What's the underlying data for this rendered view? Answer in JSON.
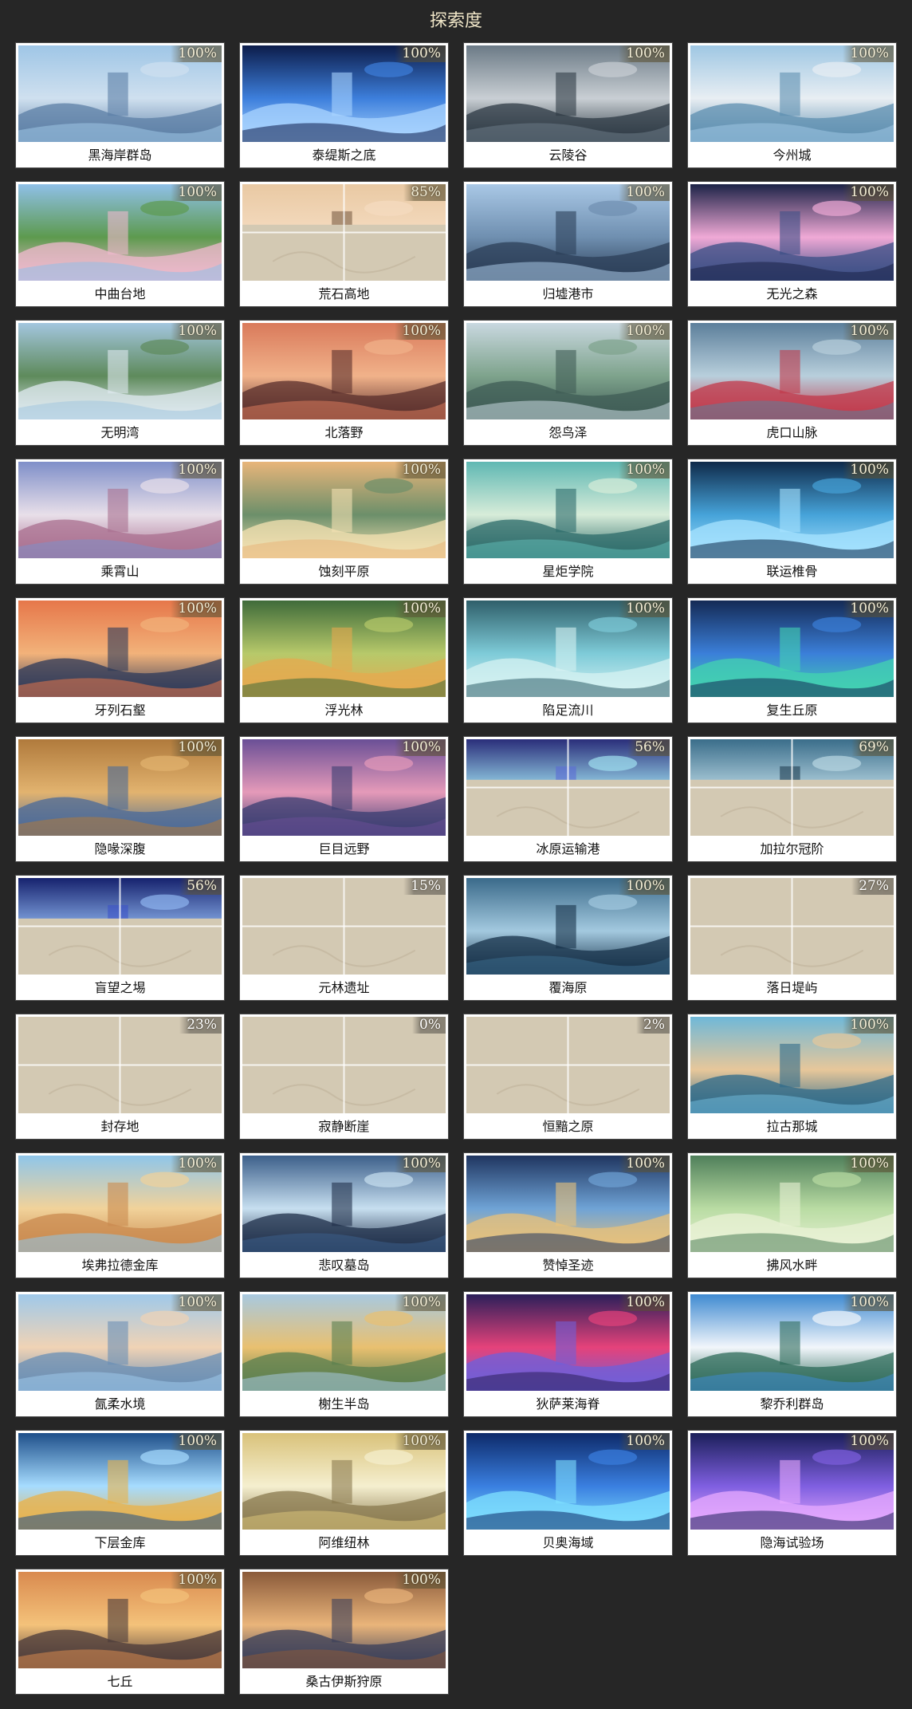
{
  "header": {
    "title": "探索度"
  },
  "regions": [
    {
      "name": "黑海岸群岛",
      "progress": "100%",
      "image": "region-thumbnail-image",
      "reveal": 1,
      "palette": [
        "#9fc6e6",
        "#cfe0ef",
        "#5c7fa6"
      ]
    },
    {
      "name": "泰缇斯之底",
      "progress": "100%",
      "image": "region-thumbnail-image",
      "reveal": 1,
      "palette": [
        "#0c1c4a",
        "#3d7fdc",
        "#a9d4ff"
      ]
    },
    {
      "name": "云陵谷",
      "progress": "100%",
      "image": "region-thumbnail-image",
      "reveal": 1,
      "palette": [
        "#6b7a86",
        "#c9cfd4",
        "#2e3a44"
      ]
    },
    {
      "name": "今州城",
      "progress": "100%",
      "image": "region-thumbnail-image",
      "reveal": 1,
      "palette": [
        "#9fc7e3",
        "#e8eef3",
        "#5e8fb0"
      ]
    },
    {
      "name": "中曲台地",
      "progress": "100%",
      "image": "region-thumbnail-image",
      "reveal": 1,
      "palette": [
        "#8fc0e8",
        "#5d9a4e",
        "#f0b9cf"
      ]
    },
    {
      "name": "荒石高地",
      "progress": "85%",
      "image": "region-thumbnail-image",
      "reveal": 0.85,
      "palette": [
        "#e9c9a3",
        "#f5dcc1",
        "#7a5d45"
      ]
    },
    {
      "name": "归墟港市",
      "progress": "100%",
      "image": "region-thumbnail-image",
      "reveal": 1,
      "palette": [
        "#a9c8e6",
        "#6f8fb0",
        "#2c3f58"
      ]
    },
    {
      "name": "无光之森",
      "progress": "100%",
      "image": "region-thumbnail-image",
      "reveal": 1,
      "palette": [
        "#1c2347",
        "#f0a9d6",
        "#3b4f86"
      ]
    },
    {
      "name": "无明湾",
      "progress": "100%",
      "image": "region-thumbnail-image",
      "reveal": 1,
      "palette": [
        "#a3c6df",
        "#5e8a5b",
        "#dfe9f0"
      ]
    },
    {
      "name": "北落野",
      "progress": "100%",
      "image": "region-thumbnail-image",
      "reveal": 1,
      "palette": [
        "#d97a5b",
        "#f1b28a",
        "#5a2f2c"
      ]
    },
    {
      "name": "怨鸟泽",
      "progress": "100%",
      "image": "region-thumbnail-image",
      "reveal": 1,
      "palette": [
        "#c9d8e0",
        "#7ea38c",
        "#3f5c55"
      ]
    },
    {
      "name": "虎口山脉",
      "progress": "100%",
      "image": "region-thumbnail-image",
      "reveal": 1,
      "palette": [
        "#5c7f9b",
        "#b8cfdc",
        "#c2384a"
      ]
    },
    {
      "name": "乘霄山",
      "progress": "100%",
      "image": "region-thumbnail-image",
      "reveal": 1,
      "palette": [
        "#7f8fc9",
        "#e8dfe9",
        "#a96f8f"
      ]
    },
    {
      "name": "蚀刻平原",
      "progress": "100%",
      "image": "region-thumbnail-image",
      "reveal": 1,
      "palette": [
        "#e8b57a",
        "#6c8f6a",
        "#f4e1b2"
      ]
    },
    {
      "name": "星炬学院",
      "progress": "100%",
      "image": "region-thumbnail-image",
      "reveal": 1,
      "palette": [
        "#5fb8b3",
        "#d7ecd9",
        "#2c6b6a"
      ]
    },
    {
      "name": "联运椎骨",
      "progress": "100%",
      "image": "region-thumbnail-image",
      "reveal": 1,
      "palette": [
        "#0f2a4a",
        "#46a3d9",
        "#a7e3ff"
      ]
    },
    {
      "name": "牙列石壑",
      "progress": "100%",
      "image": "region-thumbnail-image",
      "reveal": 1,
      "palette": [
        "#e6774a",
        "#f2b27a",
        "#2d3a5a"
      ]
    },
    {
      "name": "浮光林",
      "progress": "100%",
      "image": "region-thumbnail-image",
      "reveal": 1,
      "palette": [
        "#3f6b3a",
        "#b7c96a",
        "#e6a94f"
      ]
    },
    {
      "name": "陷足流川",
      "progress": "100%",
      "image": "region-thumbnail-image",
      "reveal": 1,
      "palette": [
        "#2f5f6a",
        "#7ecbd8",
        "#d6f2f2"
      ]
    },
    {
      "name": "复生丘原",
      "progress": "100%",
      "image": "region-thumbnail-image",
      "reveal": 1,
      "palette": [
        "#142a55",
        "#3b7fd9",
        "#43d3b0"
      ]
    },
    {
      "name": "隐喙深腹",
      "progress": "100%",
      "image": "region-thumbnail-image",
      "reveal": 1,
      "palette": [
        "#b07a3c",
        "#e2b36f",
        "#4a6a9a"
      ]
    },
    {
      "name": "巨目远野",
      "progress": "100%",
      "image": "region-thumbnail-image",
      "reveal": 1,
      "palette": [
        "#6a4f96",
        "#e59ab9",
        "#3a3d72"
      ]
    },
    {
      "name": "冰原运输港",
      "progress": "56%",
      "image": "region-thumbnail-image",
      "reveal": 0.56,
      "palette": [
        "#2a2e7a",
        "#9fdff0",
        "#5a6bd6"
      ]
    },
    {
      "name": "加拉尔冠阶",
      "progress": "69%",
      "image": "region-thumbnail-image",
      "reveal": 0.69,
      "palette": [
        "#3a6d8a",
        "#b9d7e3",
        "#1f3d52"
      ]
    },
    {
      "name": "盲望之埸",
      "progress": "56%",
      "image": "region-thumbnail-image",
      "reveal": 0.56,
      "palette": [
        "#16226e",
        "#8fb5ef",
        "#3b52c8"
      ]
    },
    {
      "name": "元林遗址",
      "progress": "15%",
      "image": "region-thumbnail-image",
      "reveal": 0.15,
      "palette": [
        "#d8cfbb",
        "#c9bfa6",
        "#b4a98f"
      ]
    },
    {
      "name": "覆海原",
      "progress": "100%",
      "image": "region-thumbnail-image",
      "reveal": 1,
      "palette": [
        "#3a6a8a",
        "#a3c9df",
        "#17324a"
      ]
    },
    {
      "name": "落日堤屿",
      "progress": "27%",
      "image": "region-thumbnail-image",
      "reveal": 0.27,
      "palette": [
        "#b9a3d4",
        "#e8e1f2",
        "#6c6aa8"
      ]
    },
    {
      "name": "封存地",
      "progress": "23%",
      "image": "region-thumbnail-image",
      "reveal": 0.23,
      "palette": [
        "#d8cfbb",
        "#c9bfa6",
        "#b4a98f"
      ]
    },
    {
      "name": "寂静断崖",
      "progress": "0%",
      "image": "region-thumbnail-image",
      "reveal": 0,
      "palette": [
        "#d8cfbb",
        "#c9bfa6",
        "#b4a98f"
      ]
    },
    {
      "name": "恒黯之原",
      "progress": "2%",
      "image": "region-thumbnail-image",
      "reveal": 0.02,
      "palette": [
        "#d8cfbb",
        "#c9bfa6",
        "#b4a98f"
      ]
    },
    {
      "name": "拉古那城",
      "progress": "100%",
      "image": "region-thumbnail-image",
      "reveal": 1,
      "palette": [
        "#6fb8d8",
        "#e7c79a",
        "#2e6a8a"
      ]
    },
    {
      "name": "埃弗拉德金库",
      "progress": "100%",
      "image": "region-thumbnail-image",
      "reveal": 1,
      "palette": [
        "#8fc6ea",
        "#f1d29a",
        "#c98a4f"
      ]
    },
    {
      "name": "悲叹墓岛",
      "progress": "100%",
      "image": "region-thumbnail-image",
      "reveal": 1,
      "palette": [
        "#3c5f8a",
        "#c7dff0",
        "#1f2f4a"
      ]
    },
    {
      "name": "赞悼圣迹",
      "progress": "100%",
      "image": "region-thumbnail-image",
      "reveal": 1,
      "palette": [
        "#1f3560",
        "#6fa3d6",
        "#e9c27a"
      ]
    },
    {
      "name": "拂风水畔",
      "progress": "100%",
      "image": "region-thumbnail-image",
      "reveal": 1,
      "palette": [
        "#4f7f5a",
        "#b9dca3",
        "#e9f2d6"
      ]
    },
    {
      "name": "氤柔水境",
      "progress": "100%",
      "image": "region-thumbnail-image",
      "reveal": 1,
      "palette": [
        "#9fc9ea",
        "#f0d3b5",
        "#6a8fb5"
      ]
    },
    {
      "name": "榭生半岛",
      "progress": "100%",
      "image": "region-thumbnail-image",
      "reveal": 1,
      "palette": [
        "#a8c9e0",
        "#e9c070",
        "#5a7f4f"
      ]
    },
    {
      "name": "狄萨莱海脊",
      "progress": "100%",
      "image": "region-thumbnail-image",
      "reveal": 1,
      "palette": [
        "#2b1f5a",
        "#e5427a",
        "#6f5fd9"
      ]
    },
    {
      "name": "黎乔利群岛",
      "progress": "100%",
      "image": "region-thumbnail-image",
      "reveal": 1,
      "palette": [
        "#3f8ad1",
        "#f2f6fb",
        "#2d6b5a"
      ]
    },
    {
      "name": "下层金库",
      "progress": "100%",
      "image": "region-thumbnail-image",
      "reveal": 1,
      "palette": [
        "#1e4f8a",
        "#a6dcff",
        "#e9b24a"
      ]
    },
    {
      "name": "阿维纽林",
      "progress": "100%",
      "image": "region-thumbnail-image",
      "reveal": 1,
      "palette": [
        "#d9c27a",
        "#f5efcf",
        "#8a7a4f"
      ]
    },
    {
      "name": "贝奥海域",
      "progress": "100%",
      "image": "region-thumbnail-image",
      "reveal": 1,
      "palette": [
        "#0d2a6a",
        "#3a7fe0",
        "#7fe0ff"
      ]
    },
    {
      "name": "隐海试验场",
      "progress": "100%",
      "image": "region-thumbnail-image",
      "reveal": 1,
      "palette": [
        "#1b1f5a",
        "#7f5fe0",
        "#e7a9ff"
      ]
    },
    {
      "name": "七丘",
      "progress": "100%",
      "image": "region-thumbnail-image",
      "reveal": 1,
      "palette": [
        "#d98a4f",
        "#f4c27a",
        "#4a3a3a"
      ]
    },
    {
      "name": "桑古伊斯狩原",
      "progress": "100%",
      "image": "region-thumbnail-image",
      "reveal": 1,
      "palette": [
        "#8a5a3a",
        "#e9b47a",
        "#3a3f5a"
      ]
    }
  ]
}
